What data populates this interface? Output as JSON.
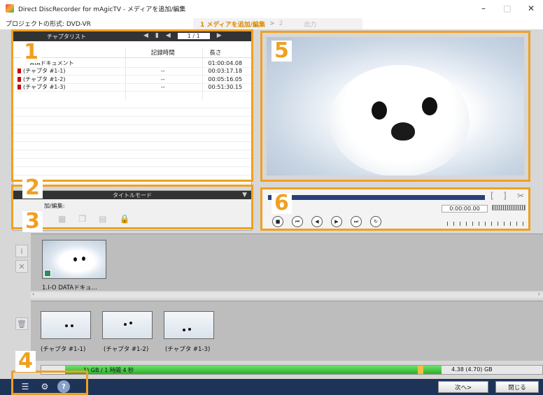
{
  "window": {
    "title": "Direct DiscRecorder for mAgicTV - メディアを追加/編集",
    "minimize": "–",
    "maximize": "□",
    "close": "✕"
  },
  "menubar": {
    "project_format": "プロジェクトの形式: DVD-VR",
    "step1": "1 メディアを追加/編集",
    "step_arrow": ">",
    "step2": "2",
    "step_output": "出力"
  },
  "chapter_list": {
    "header": "チャプタリスト",
    "page": "1 / 1",
    "columns": [
      "",
      "記録時間",
      "長さ"
    ],
    "rows": [
      {
        "name": "ATAドキュメント",
        "rec": "",
        "len": "01:00:04.08",
        "flag": false
      },
      {
        "name": "(チャプタ #1-1)",
        "rec": "--",
        "len": "00:03:17.18",
        "flag": true
      },
      {
        "name": "(チャプタ #1-2)",
        "rec": "--",
        "len": "00:05:16.05",
        "flag": true
      },
      {
        "name": "(チャプタ #1-3)",
        "rec": "--",
        "len": "00:51:30.15",
        "flag": true
      }
    ]
  },
  "title_mode": {
    "header": "タイトルモード",
    "label": "加/編集:"
  },
  "playback": {
    "timecode": "0:00:00.00"
  },
  "titles": [
    {
      "label": "1.I-O DATAドキュ..."
    }
  ],
  "chapters": [
    {
      "label": "(チャプタ #1-1)"
    },
    {
      "label": "(チャプタ #1-2)"
    },
    {
      "label": "(チャプタ #1-3)"
    }
  ],
  "capacity": {
    "used_text": "1) GB / 1 時間 4 秒",
    "total_text": "4.38 (4.70) GB"
  },
  "footer": {
    "next": "次へ>",
    "close": "閉じる"
  },
  "callouts": [
    "1",
    "2",
    "3",
    "4",
    "5",
    "6"
  ],
  "colors": {
    "accent_orange": "#f0a020",
    "footer_navy": "#1e3358",
    "progress_navy": "#2a3e7a",
    "capacity_green": "#2ab02a"
  }
}
